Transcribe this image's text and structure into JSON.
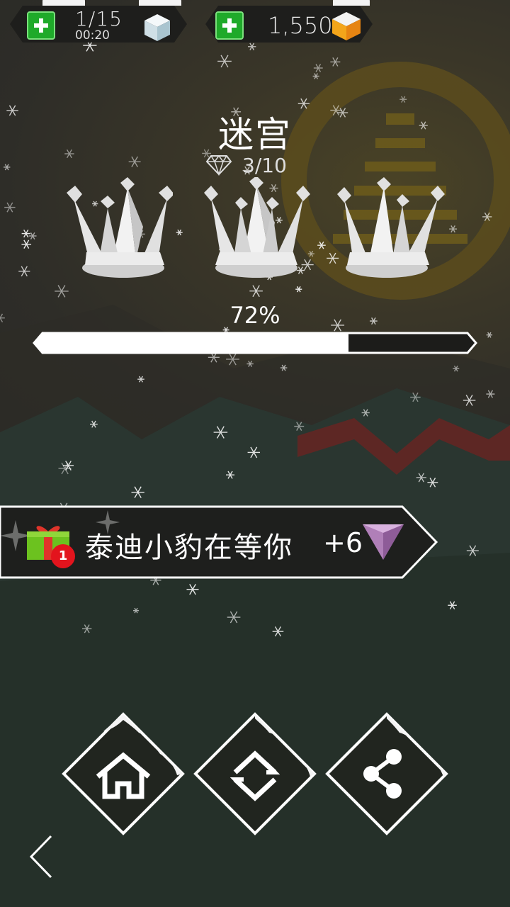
{
  "hud": {
    "lives": "1/15",
    "lives_timer": "00:20",
    "gems": "1,550"
  },
  "level": {
    "title": "迷宫",
    "diamonds": "3/10",
    "crowns_earned": 0,
    "crowns_total": 3
  },
  "progress": {
    "label": "72%",
    "value": 0.72
  },
  "gift_banner": {
    "text": "泰迪小豹在等你",
    "bonus": "+6",
    "badge": "1"
  },
  "buttons": {
    "home_icon": "home-icon",
    "restart_icon": "restart-icon",
    "share_icon": "share-icon",
    "back_icon": "chevron-left-icon"
  },
  "colors": {
    "accent_green": "#1faa2a",
    "badge_red": "#e3141d",
    "gem_purple": "#b07fb8"
  }
}
